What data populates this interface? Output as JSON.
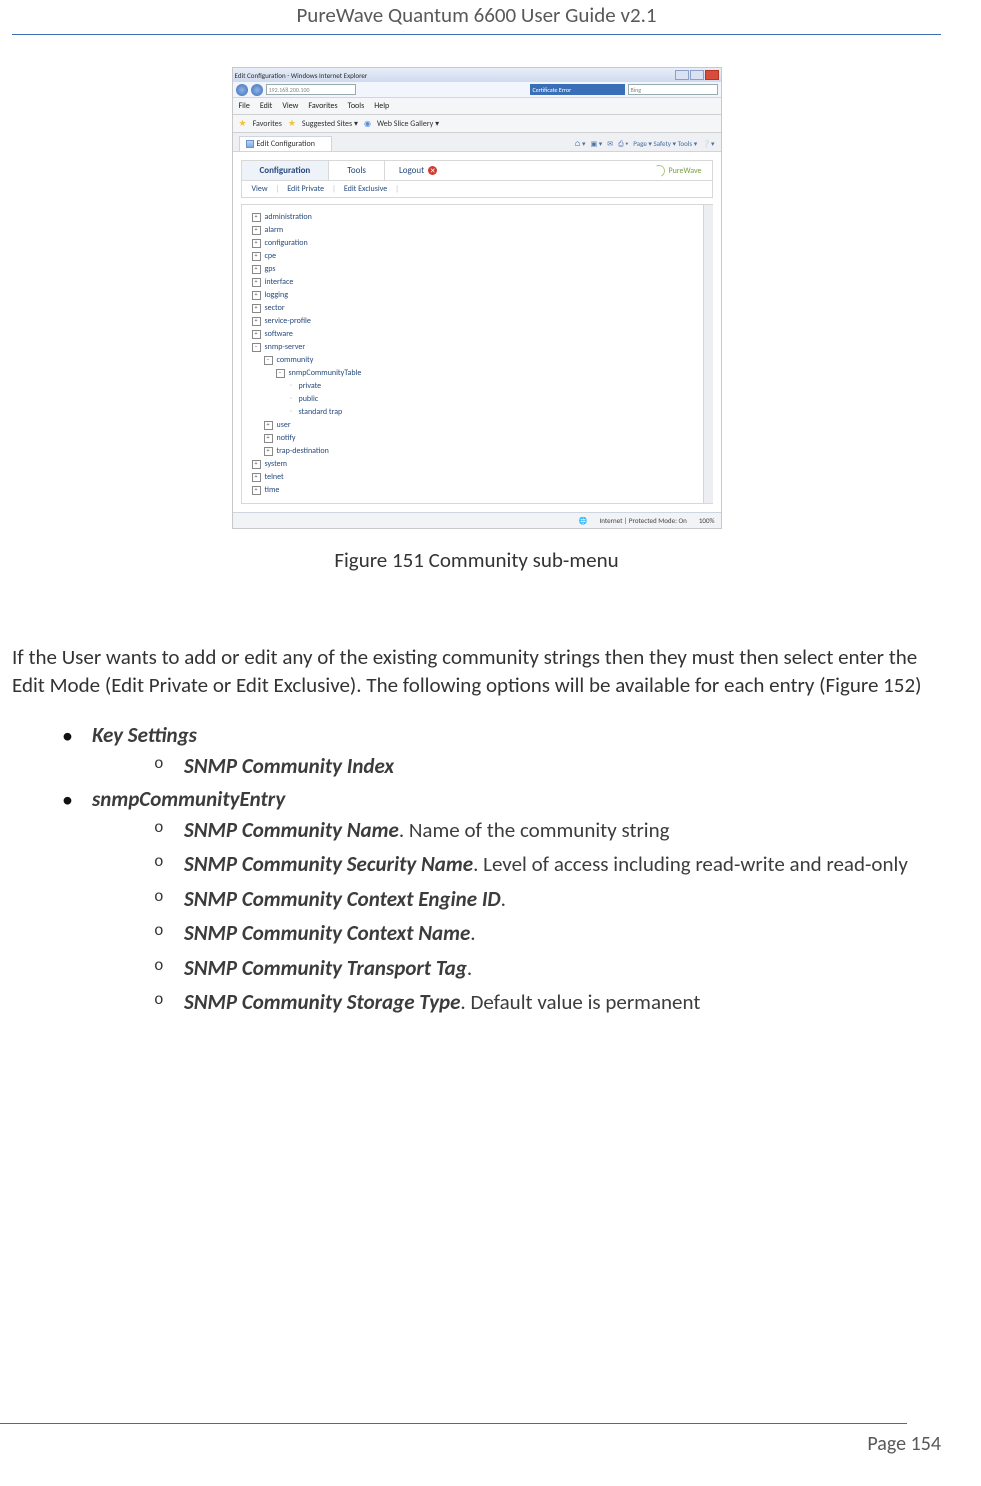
{
  "header": {
    "title": "PureWave Quantum 6600 User Guide v2.1"
  },
  "figure": {
    "window_title": "Edit Configuration - Windows Internet Explorer",
    "address_hint": "192.168.200.100",
    "cert_label": "Certificate Error",
    "search_hint": "Bing",
    "menubar": [
      "File",
      "Edit",
      "View",
      "Favorites",
      "Tools",
      "Help"
    ],
    "favbar": {
      "label": "Favorites",
      "suggested": "Suggested Sites ▾",
      "webslice": "Web Slice Gallery ▾"
    },
    "tab_label": "Edit Configuration",
    "toolbar_text": "Page ▾   Safety ▾   Tools ▾",
    "app_tabs": {
      "config": "Configuration",
      "tools": "Tools",
      "logout": "Logout"
    },
    "brand": "PureWave",
    "view_bar": {
      "view": "View",
      "edit_private": "Edit Private",
      "edit_exclusive": "Edit Exclusive"
    },
    "tree": {
      "n0": "administration",
      "n1": "alarm",
      "n2": "configuration",
      "n3": "cpe",
      "n4": "gps",
      "n5": "interface",
      "n6": "logging",
      "n7": "sector",
      "n8": "service-profile",
      "n9": "software",
      "n10": "snmp-server",
      "n10a": "community",
      "n10a1": "snmpCommunityTable",
      "n10a1a": "private",
      "n10a1b": "public",
      "n10a1c": "standard trap",
      "n10b": "user",
      "n10c": "notify",
      "n10d": "trap-destination",
      "n11": "system",
      "n12": "telnet",
      "n13": "time"
    },
    "status": {
      "zone": "Internet | Protected Mode: On",
      "zoom": "100%"
    },
    "caption": "Figure 151 Community sub-menu"
  },
  "body": {
    "para": "If the User wants to add or edit any of the existing community strings then they must then select enter the Edit Mode (Edit Private or Edit Exclusive).   The following options will be available for each entry (Figure 152)"
  },
  "list": {
    "l1": "Key Settings",
    "l1a": "SNMP Community Index",
    "l2": "snmpCommunityEntry",
    "l2a_term": "SNMP Community Name",
    "l2a_desc": ". Name of the community string",
    "l2b_term": "SNMP Community Security Name",
    "l2b_desc": ". Level of access including read-write and read-only",
    "l2c_term": "SNMP Community Context Engine ID",
    "l2c_desc": ".",
    "l2d_term": "SNMP Community Context Name",
    "l2d_desc": ".",
    "l2e_term": "SNMP Community Transport Tag",
    "l2e_desc": ".",
    "l2f_term": "SNMP Community Storage Type",
    "l2f_desc": ". Default value is permanent"
  },
  "footer": {
    "page": "Page 154"
  }
}
